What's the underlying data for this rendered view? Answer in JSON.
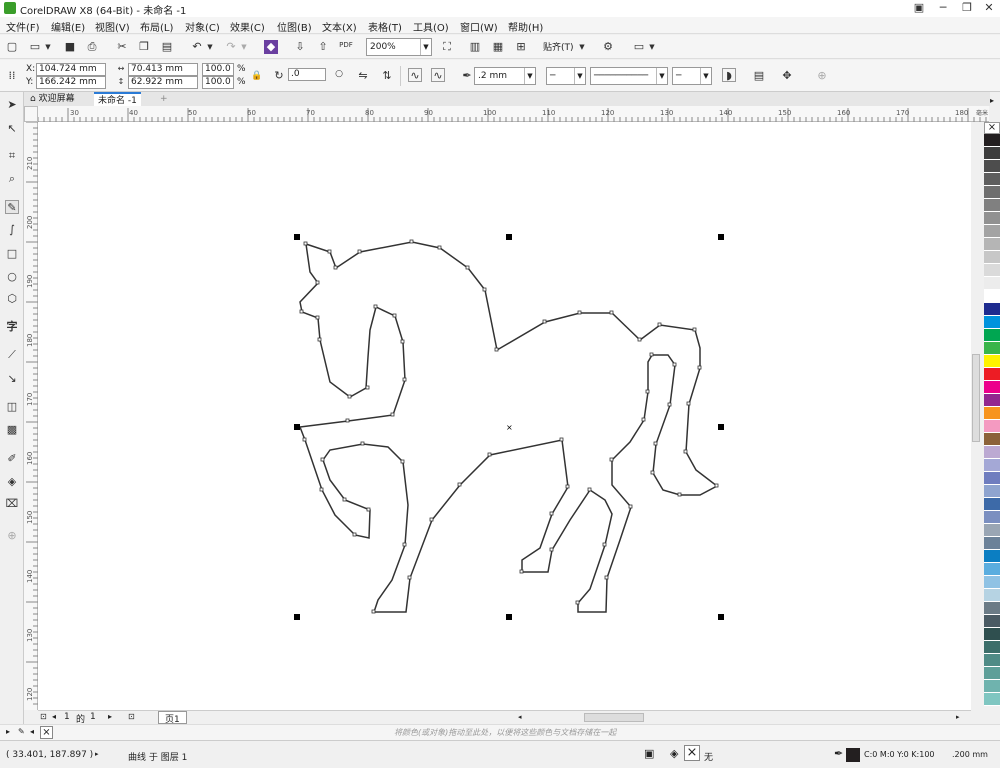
{
  "window": {
    "title": "CorelDRAW X8 (64-Bit) - 未命名 -1"
  },
  "menu": [
    "文件(F)",
    "编辑(E)",
    "视图(V)",
    "布局(L)",
    "对象(C)",
    "效果(C)",
    "位图(B)",
    "文本(X)",
    "表格(T)",
    "工具(O)",
    "窗口(W)",
    "帮助(H)"
  ],
  "toolbar": {
    "zoom": "200%",
    "snap_label": "贴齐(T)",
    "pdf_label": "PDF"
  },
  "property_bar": {
    "x": "104.724 mm",
    "y": "166.242 mm",
    "width": "70.413 mm",
    "height": "62.922 mm",
    "scale_x": "100.0",
    "scale_y": "100.0",
    "unit": "%",
    "angle": ".0",
    "outline_width": ".2 mm"
  },
  "tabs": [
    {
      "label": "欢迎屏幕"
    },
    {
      "label": "未命名 -1"
    }
  ],
  "ruler": {
    "h_ticks": [
      "30",
      "40",
      "50",
      "60",
      "70",
      "80",
      "90",
      "100",
      "110",
      "120",
      "130",
      "140",
      "150",
      "160",
      "170",
      "180"
    ],
    "h_unit": "毫米",
    "v_ticks": [
      "210",
      "200",
      "190",
      "180",
      "170",
      "160",
      "150",
      "140",
      "130",
      "120"
    ]
  },
  "page_nav": {
    "current": "1",
    "of_label": "的",
    "total": "1",
    "page_tab": "页1"
  },
  "hint": "将颜色(或对象)拖动至此处，以便将这些颜色与文档存储在一起",
  "status": {
    "coords": "( 33.401, 187.897 )",
    "object_info": "曲线 于 图层 1",
    "fill_label": "无",
    "outline_color": "C:0 M:0 Y:0 K:100",
    "outline_width": ".200 mm"
  },
  "colors": {
    "accent": "#2b7bd6",
    "palette": [
      "#231f20",
      "#3d3d3d",
      "#4d4d4d",
      "#5e5e5e",
      "#6f6f6f",
      "#808080",
      "#919191",
      "#a3a3a3",
      "#b5b5b5",
      "#c7c7c7",
      "#dadada",
      "#ececec",
      "#ffffff",
      "#1e2b8f",
      "#0093dd",
      "#00a651",
      "#39b54a",
      "#fff200",
      "#ed1c24",
      "#ec008c",
      "#92278f",
      "#f7941e",
      "#f49ac1",
      "#8c6239",
      "#bca9d2",
      "#a4a8d6",
      "#6f7dbf",
      "#8fa4cf",
      "#3d6aa8",
      "#7b8fc0",
      "#9aa6b4",
      "#6c8299",
      "#0b7ec2",
      "#5aaddf",
      "#8fc2e4",
      "#b6d3e3",
      "#6b7b86",
      "#4a5a63",
      "#2f4f4f",
      "#3c6e6a",
      "#4f8b86",
      "#5e9f99",
      "#6fb3ae",
      "#7fc6c1"
    ]
  },
  "icons": {
    "pick": "pointer-icon",
    "shape": "shape-icon",
    "crop": "crop-icon",
    "zoom": "zoom-icon",
    "freehand": "freehand-icon",
    "artistic": "artistic-media-icon",
    "rect": "rectangle-icon",
    "ellipse": "ellipse-icon",
    "polygon": "polygon-icon",
    "text": "text-icon",
    "dimension": "parallel-dimension-icon",
    "connector": "connector-icon",
    "shadow": "drop-shadow-icon",
    "transparency": "transparency-icon",
    "eyedropper": "eyedropper-icon",
    "fill": "interactive-fill-icon",
    "smartfill": "smart-fill-icon",
    "add": "add-icon"
  }
}
